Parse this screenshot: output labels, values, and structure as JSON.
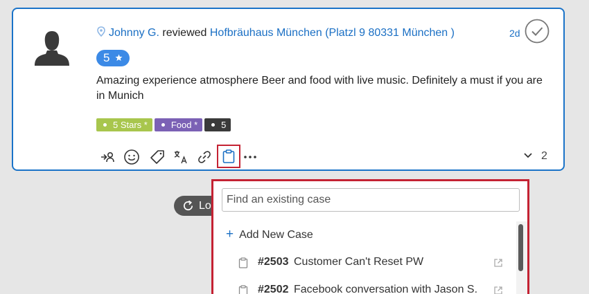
{
  "review": {
    "author": "Johnny G.",
    "action": "reviewed",
    "location": "Hofbräuhaus München (Platzl 9 80331 München )",
    "time_ago": "2d",
    "rating": "5",
    "text": "Amazing experience atmosphere Beer and food with live music. Definitely a must if you are in Munich",
    "tags": [
      {
        "label": "5 Stars *",
        "color": "#a8c64d"
      },
      {
        "label": "Food *",
        "color": "#7b61b5"
      },
      {
        "label": "5",
        "color": "#3a3a3a"
      }
    ],
    "replies_count": "2"
  },
  "toolbar": {
    "icons": [
      "assign-icon",
      "sentiment-icon",
      "tag-icon",
      "translate-icon",
      "link-icon",
      "case-icon",
      "more-icon"
    ]
  },
  "load_more": {
    "label": "Lo"
  },
  "case_dropdown": {
    "search_placeholder": "Find an existing case",
    "add_label": "Add New Case",
    "cases": [
      {
        "number": "#2503",
        "title": "Customer Can't Reset PW"
      },
      {
        "number": "#2502",
        "title": "Facebook conversation with Jason S."
      }
    ]
  },
  "colors": {
    "accent": "#1a73c8",
    "highlight": "#c42233"
  }
}
